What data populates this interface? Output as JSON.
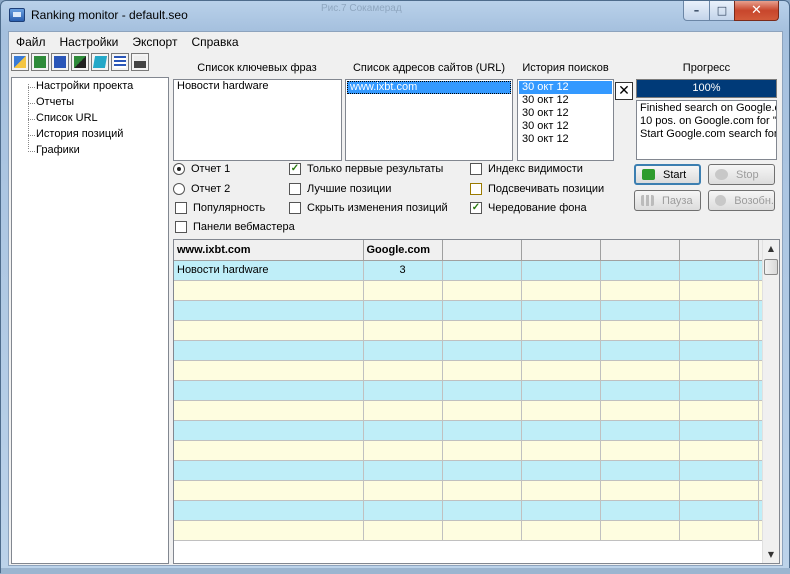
{
  "window": {
    "title": "Ranking monitor - default.seo",
    "ghost_title": "Рис.7 Сокамерад"
  },
  "menu": [
    "Файл",
    "Настройки",
    "Экспорт",
    "Справка"
  ],
  "toolbar_icons": [
    "open-icon",
    "excel-icon",
    "word-icon",
    "export-icon",
    "note-icon",
    "report-icon",
    "print-icon"
  ],
  "tree": [
    "Настройки проекта",
    "Отчеты",
    "Список URL",
    "История позиций",
    "Графики"
  ],
  "keywords": {
    "label": "Список ключевых фраз",
    "items": [
      "Новости hardware"
    ]
  },
  "urls": {
    "label": "Список адресов сайтов (URL)",
    "items": [
      "www.ixbt.com"
    ]
  },
  "history": {
    "label": "История поисков",
    "items": [
      "30 окт 12",
      "30 окт 12",
      "30 окт 12",
      "30 окт 12",
      "30 окт 12"
    ]
  },
  "progress": {
    "label": "Прогресс",
    "value": 1.0,
    "text": "100%",
    "log": [
      "Finished search on Google.c",
      "10 pos. on Google.com for ''",
      "Start Google.com search for"
    ]
  },
  "buttons": {
    "start": "Start",
    "stop": "Stop",
    "pause": "Пауза",
    "resume": "Возобн."
  },
  "options": {
    "report1": {
      "label": "Отчет 1",
      "checked": true
    },
    "report2": {
      "label": "Отчет 2",
      "checked": false
    },
    "popularity": {
      "label": "Популярность",
      "checked": false
    },
    "webmaster": {
      "label": "Панели вебмастера",
      "checked": false
    },
    "first_results": {
      "label": "Только первые результаты",
      "checked": true
    },
    "best_positions": {
      "label": "Лучшие позиции",
      "checked": false
    },
    "hide_changes": {
      "label": "Скрыть изменения позиций",
      "checked": false
    },
    "visibility_index": {
      "label": "Индекс видимости",
      "checked": false
    },
    "highlight_positions": {
      "label": "Подсвечивать позиции",
      "checked": false
    },
    "alternate_bg": {
      "label": "Чередование фона",
      "checked": true
    }
  },
  "grid": {
    "headers": [
      "www.ixbt.com",
      "Google.com",
      "",
      "",
      "",
      "",
      ""
    ],
    "rows": [
      [
        "Новости hardware",
        "3",
        "",
        "",
        "",
        "",
        ""
      ]
    ],
    "empty_rows": 13
  },
  "colors": {
    "row_blue": "#bfeef8",
    "row_cream": "#fefde0",
    "progress_fill": "#003a78"
  }
}
